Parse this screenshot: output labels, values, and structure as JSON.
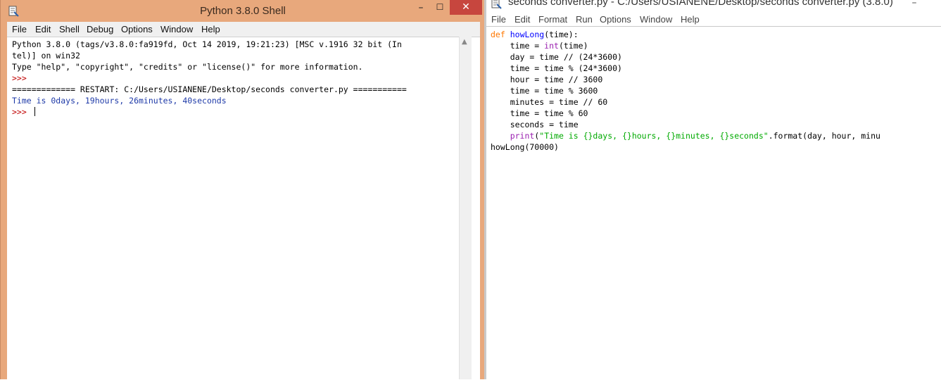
{
  "shell_window": {
    "title": "Python 3.8.0 Shell",
    "controls": {
      "minimize": "–",
      "maximize": "☐",
      "close": "✕"
    },
    "menu": [
      "File",
      "Edit",
      "Shell",
      "Debug",
      "Options",
      "Window",
      "Help"
    ],
    "output": {
      "banner_line1": "Python 3.8.0 (tags/v3.8.0:fa919fd, Oct 14 2019, 19:21:23) [MSC v.1916 32 bit (In",
      "banner_line2": "tel)] on win32",
      "info_line": "Type \"help\", \"copyright\", \"credits\" or \"license()\" for more information.",
      "prompt1": ">>> ",
      "restart_line": "============= RESTART: C:/Users/USIANENE/Desktop/seconds converter.py ===========",
      "result_line": "Time is 0days, 19hours, 26minutes, 40seconds",
      "prompt2": ">>> "
    }
  },
  "editor_window": {
    "title": "seconds converter.py - C:/Users/USIANENE/Desktop/seconds converter.py (3.8.0)",
    "controls": {
      "minimize": "–"
    },
    "menu": [
      "File",
      "Edit",
      "Format",
      "Run",
      "Options",
      "Window",
      "Help"
    ],
    "code": {
      "l1_kw": "def",
      "l1_name": "howLong",
      "l1_rest": "(time):",
      "l2_a": "    time = ",
      "l2_builtin": "int",
      "l2_b": "(time)",
      "l3": "    day = time // (24*3600)",
      "l4": "    time = time % (24*3600)",
      "l5": "    hour = time // 3600",
      "l6": "    time = time % 3600",
      "l7": "    minutes = time // 60",
      "l8": "    time = time % 60",
      "l9": "    seconds = time",
      "l10_indent": "    ",
      "l10_builtin": "print",
      "l10_paren": "(",
      "l10_string": "\"Time is {}days, {}hours, {}minutes, {}seconds\"",
      "l10_rest": ".format(day, hour, minu",
      "l11": "howLong(70000)"
    }
  },
  "colors": {
    "window_frame": "#e8a87c",
    "close_button": "#c7463e",
    "prompt": "#c00000",
    "stdout": "#1e3aa8",
    "keyword": "#ff7700",
    "builtin": "#9a1fb0",
    "string": "#00aa00"
  }
}
